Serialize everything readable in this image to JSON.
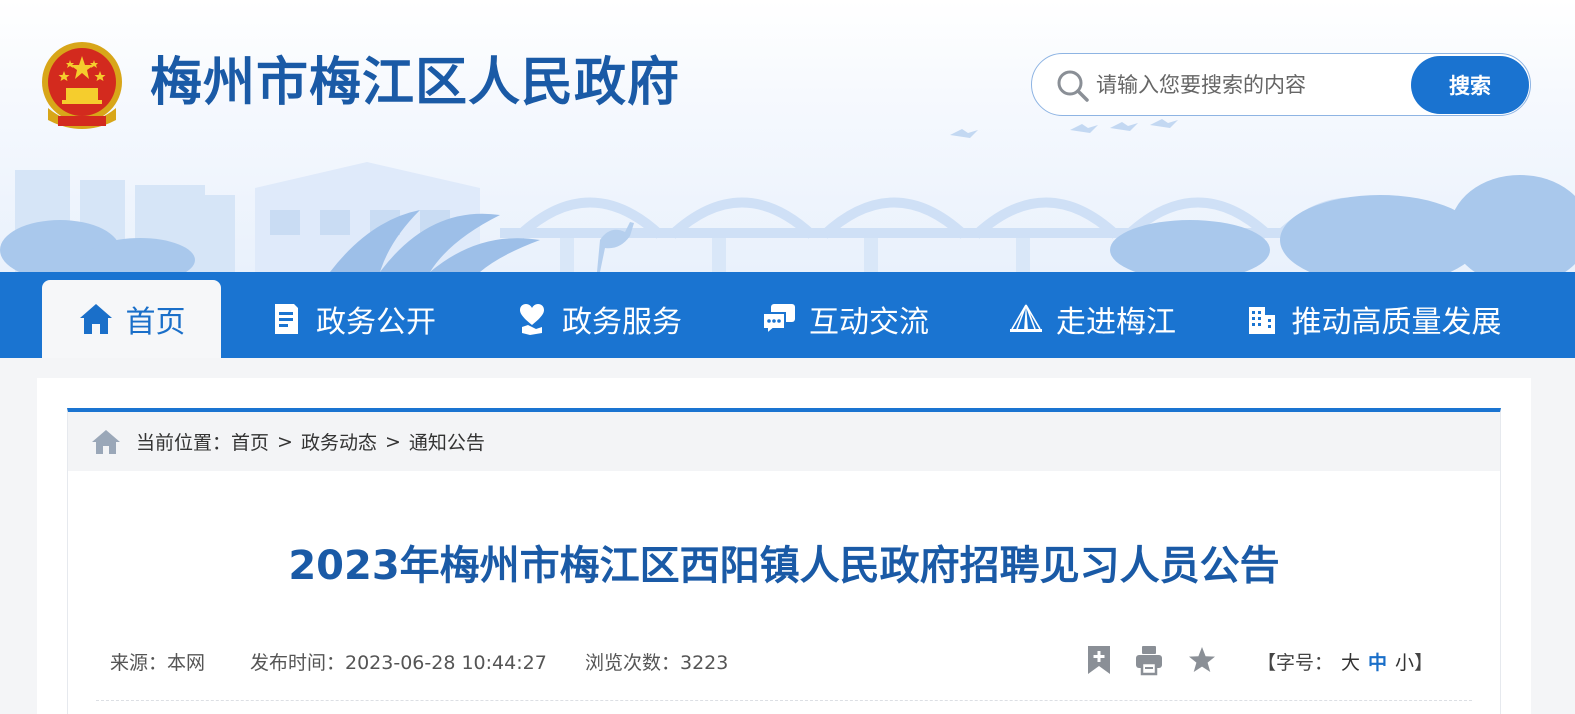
{
  "header": {
    "site_title": "梅州市梅江区人民政府",
    "emblem": "national-emblem"
  },
  "search": {
    "placeholder": "请输入您要搜索的内容",
    "button_label": "搜索",
    "icon": "search-icon"
  },
  "nav": {
    "items": [
      {
        "label": "首页",
        "icon": "home-icon",
        "active": true
      },
      {
        "label": "政务公开",
        "icon": "document-icon",
        "active": false
      },
      {
        "label": "政务服务",
        "icon": "heart-hand-icon",
        "active": false
      },
      {
        "label": "互动交流",
        "icon": "chat-icon",
        "active": false
      },
      {
        "label": "走进梅江",
        "icon": "bridge-icon",
        "active": false
      },
      {
        "label": "推动高质量发展",
        "icon": "building-icon",
        "active": false
      }
    ]
  },
  "breadcrumb": {
    "prefix": "当前位置：",
    "items": [
      "首页",
      "政务动态",
      "通知公告"
    ],
    "separator": ">"
  },
  "article": {
    "title": "2023年梅州市梅江区西阳镇人民政府招聘见习人员公告",
    "source": "来源：本网",
    "publish_time": "发布时间：2023-06-28 10:44:27",
    "views": "浏览次数：3223"
  },
  "tools": {
    "bookmark": "bookmark-icon",
    "print": "print-icon",
    "favorite": "star-icon"
  },
  "font_size": {
    "open": "【字号：",
    "options": [
      "大",
      "中",
      "小"
    ],
    "selected": "中",
    "close": "】"
  },
  "colors": {
    "primary": "#1a74d1",
    "title": "#1a5aa6",
    "active_tab_bg": "#f6f7f9"
  }
}
